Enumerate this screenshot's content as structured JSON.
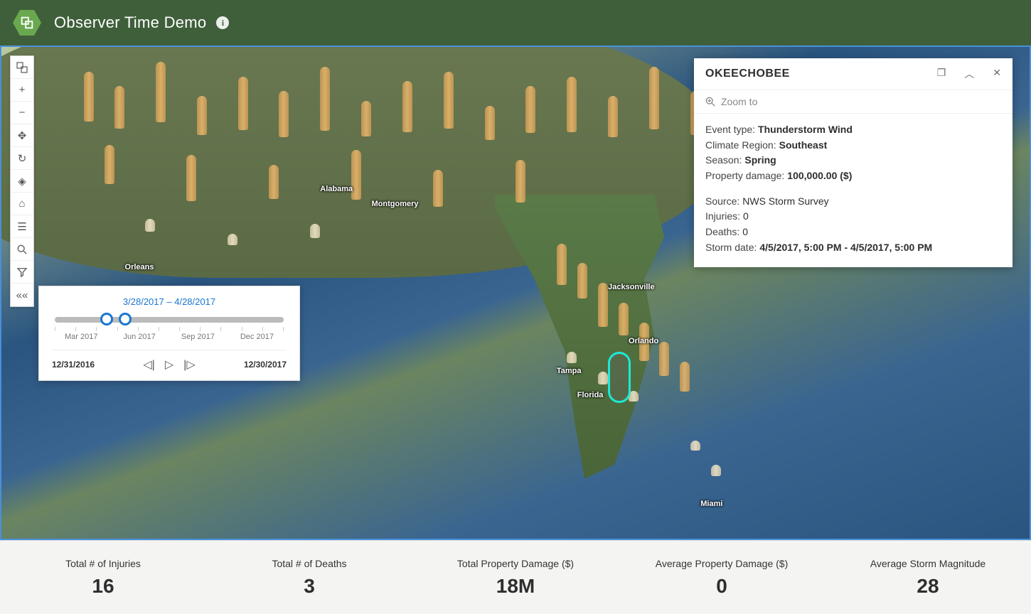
{
  "header": {
    "title": "Observer Time Demo"
  },
  "map_labels": {
    "alabama": "Alabama",
    "montgomery": "Montgomery",
    "jacksonville": "Jacksonville",
    "orlando": "Orlando",
    "tampa": "Tampa",
    "florida": "Florida",
    "miami": "Miami",
    "orleans": "Orleans"
  },
  "time_slider": {
    "range_start": "3/28/2017",
    "range_sep": "–",
    "range_end": "4/28/2017",
    "ticks": [
      "Mar 2017",
      "Jun 2017",
      "Sep 2017",
      "Dec 2017"
    ],
    "extent_start": "12/31/2016",
    "extent_end": "12/30/2017"
  },
  "popup": {
    "title": "OKEECHOBEE",
    "zoom": "Zoom to",
    "fields": {
      "event_type_lbl": "Event type:",
      "event_type": "Thunderstorm Wind",
      "climate_region_lbl": "Climate Region:",
      "climate_region": "Southeast",
      "season_lbl": "Season:",
      "season": "Spring",
      "prop_damage_lbl": "Property damage:",
      "prop_damage": "100,000.00 ($)",
      "source_lbl": "Source:",
      "source": "NWS Storm Survey",
      "injuries_lbl": "Injuries:",
      "injuries": "0",
      "deaths_lbl": "Deaths:",
      "deaths": "0",
      "storm_date_lbl": "Storm date:",
      "storm_date": "4/5/2017, 5:00 PM  - 4/5/2017, 5:00 PM"
    }
  },
  "stats": [
    {
      "label": "Total # of Injuries",
      "value": "16"
    },
    {
      "label": "Total # of Deaths",
      "value": "3"
    },
    {
      "label": "Total Property Damage ($)",
      "value": "18M"
    },
    {
      "label": "Average Property Damage ($)",
      "value": "0"
    },
    {
      "label": "Average Storm Magnitude",
      "value": "28"
    }
  ]
}
